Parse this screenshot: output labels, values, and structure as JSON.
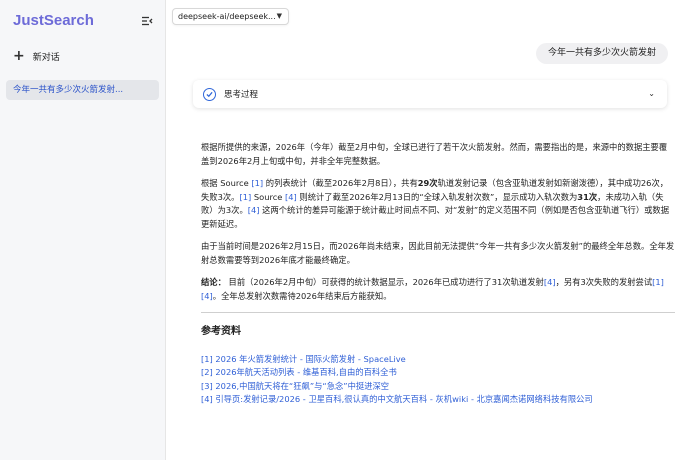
{
  "sidebar": {
    "brand": "JustSearch",
    "new_chat_label": "新对话",
    "history": [
      {
        "label": "今年一共有多少次火箭发射..."
      }
    ]
  },
  "header": {
    "model_label": "deepseek-ai/deepseek..."
  },
  "user_message": "今年一共有多少次火箭发射",
  "thinking": {
    "label": "思考过程"
  },
  "answer": {
    "p1": "根据所提供的来源，2026年（今年）截至2月中旬，全球已进行了若干次火箭发射。然而，需要指出的是，来源中的数据主要覆盖到2026年2月上旬或中旬，并非全年完整数据。",
    "p2_a": "根据 Source ",
    "p2_c1": "[1]",
    "p2_b": " 的列表统计（截至2026年2月8日），共有",
    "p2_bold1": "29次",
    "p2_c": "轨道发射记录（包含亚轨道发射如新谢泼德），其中成功26次，失败3次。",
    "p2_c2": "[1]",
    "p2_d": " Source ",
    "p2_c3": "[4]",
    "p2_e": " 则统计了截至2026年2月13日的“全球入轨发射次数”，显示成功入轨次数为",
    "p2_bold2": "31次",
    "p2_f": "，未成功入轨（失败）为3次。",
    "p2_c4": "[4]",
    "p2_g": " 这两个统计的差异可能源于统计截止时间点不同、对“发射”的定义范围不同（例如是否包含亚轨道飞行）或数据更新延迟。",
    "p3": "由于当前时间是2026年2月15日，而2026年尚未结束，因此目前无法提供“今年一共有多少次火箭发射”的最终全年总数。全年发射总数需要等到2026年底才能最终确定。",
    "p4_label": "结论：",
    "p4_a": " 目前（2026年2月中旬）可获得的统计数据显示，2026年已成功进行了31次轨道发射",
    "p4_c1": "[4]",
    "p4_b": "，另有3次失败的发射尝试",
    "p4_c2": "[1]",
    "p4_c3": "[4]",
    "p4_c": "。全年总发射次数需待2026年结束后方能获知。"
  },
  "references": {
    "title": "参考资料",
    "items": [
      "[1]  2026 年火箭发射统计 - 国际火箭发射 - SpaceLive",
      "[2]  2026年航天活动列表 - 维基百科,自由的百科全书",
      "[3]  2026,中国航天将在“狂飙”与“急念”中挺进深空",
      "[4]  引导页:发射记录/2026 - 卫星百科,很认真的中文航天百科 - 灰机wiki - 北京嘉闻杰诺网络科技有限公司"
    ]
  },
  "colors": {
    "brand": "#6d6bd8",
    "link": "#2f5fd6",
    "accent": "#2f66d9"
  }
}
